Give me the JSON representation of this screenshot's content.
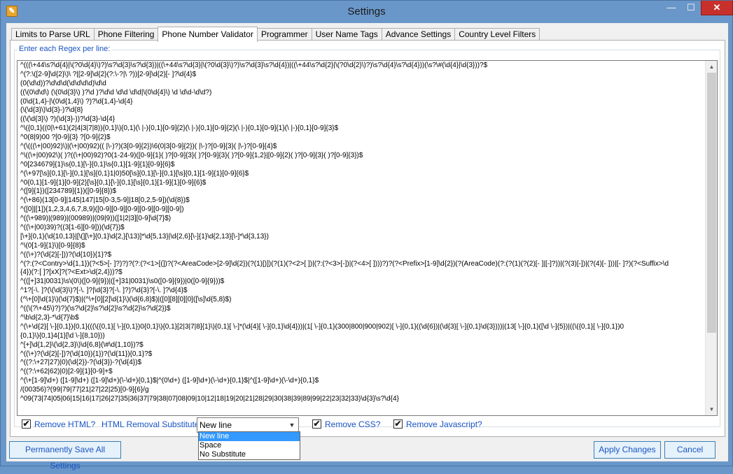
{
  "window": {
    "title": "Settings",
    "minimize_glyph": "—",
    "maximize_glyph": "☐",
    "close_glyph": "✕",
    "app_icon_glyph": "✎"
  },
  "tabs": [
    {
      "label": "Limits to Parse URL",
      "active": false
    },
    {
      "label": "Phone Filtering",
      "active": false
    },
    {
      "label": "Phone Number Validator",
      "active": true
    },
    {
      "label": "Programmer",
      "active": false
    },
    {
      "label": "User Name Tags",
      "active": false
    },
    {
      "label": "Advance Settings",
      "active": false
    },
    {
      "label": "Country Level Filters",
      "active": false
    }
  ],
  "regex_group": {
    "label": "Enter each Regex per line:",
    "lines": [
      "^(((\\+44\\s?\\d{4}|\\(?0\\d{4}\\)?)\\s?\\d{3}\\s?\\d{3})|((\\+44\\s?\\d{3}|\\(?0\\d{3}\\)?)\\s?\\d{3}\\s?\\d{4})|((\\+44\\s?\\d{2}|\\(?0\\d{2}\\)?)\\s?\\d{4}\\s?\\d{4}))(\\s?\\#(\\d{4}|\\d{3}))?$",
      "^(?:\\([2-9]\\d{2}\\)\\ ?|[2-9]\\d{2}(?:\\-?|\\ ?))[2-9]\\d{2}[- ]?\\d{4}$",
      "(0(\\d\\d))?\\d\\d\\d(\\d\\d\\d\\d)\\d\\d",
      "((\\(0\\d\\d\\) (\\(0\\d{3}\\) )?\\d )?\\d\\d \\d\\d \\d\\d|\\(0\\d{4}\\) \\d \\d\\d-\\d\\d?)",
      "(0\\d{1,4}-|\\(0\\d{1,4}\\) ?)?\\d{1,4}-\\d{4}",
      "(\\(\\d{3}\\)\\d{3}-)?\\d{8}",
      "((\\(\\d{3}\\) ?)(\\d{3}-))?\\d{3}-\\d{4}",
      "^\\({0,1}((0|\\+61)(2|4|3|7|8)){0,1}\\){0,1}(\\ |-){0,1}[0-9]{2}(\\ |-){0,1}[0-9]{2}(\\ |-){0,1}[0-9]{1}(\\ |-){0,1}[0-9]{3}$",
      "^0(8|9)00 ?[0-9]{3} ?[0-9]{2}$",
      "^(\\(((\\+|00)92)\\)|(\\+|00)92)(( |\\-)?)(3[0-9]{2})\\6(0|3[0-9]{2})( |\\-)?[0-9]{3}( |\\-)?[0-9]{4}$",
      "^\\((\\+|00)92\\)( )?((\\+|00)92)?0(1-24-9)([0-9]{1}( )?[0-9]{3}( )?[0-9]{3}( )?[0-9]{1,2}|[0-9]{2}( )?[0-9]{3}( )?[0-9]{3})$",
      "^0[234679]{1}\\s{0,1}[\\-]{0,1}\\s{0,1}[1-9]{1}[0-9]{6}$",
      "^(\\+97[\\s]{0,1}[\\-]{0,1}[\\s]{0,1}1|0)50[\\s]{0,1}[\\-]{0,1}[\\s]{0,1}[1-9]{1}[0-9]{6}$",
      "^0{0,1}[1-9]{1}[0-9]{2}[\\s]{0,1}[\\-]{0,1}[\\s]{0,1}[1-9]{1}[0-9]{6}$",
      "^([9]{1})([234789]{1})([0-9]{8})$",
      "^(\\+86)(13[0-9]|145|147|15[0-3,5-9]|18[0,2,5-9])(\\d{8})$",
      "^([0]|[1]){1,2,3,4,6,7,8,9}([0-9][0-9][0-9][0-9][0-9][0-9])",
      "^((\\+989)|(989)|(00989)|(09|9))([1|2|3][0-9]\\d{7}$)",
      "^((\\+|00)39)?((3[1-6][0-9]))(\\d{7})$",
      "[\\+]{0,1}(\\d{10,13}|[\\(][\\+]{0,1}\\d{2,}[\\13)]*\\d{5,13}|\\d{2,6}[\\-]{1}\\d{2,13}[\\-]*\\d{3,13})",
      "^\\(0[1-9]{1}\\)[0-9]{8}$",
      "^((\\+)?(\\d{2}[-]))?(\\d{10}){1}?$",
      "^(?:(?<Contry>\\d{1,1})(?<5>[- ]?)?)?(?:(?<1>[(])?(?<AreaCode>[2-9]\\d{2})(?(1)[)])(?(1)(?<2>[ ])|(?:(?<3>[-])|(?<4>[ ])))?)?(?<Prefix>[1-9]\\d{2})(?(AreaCode)(?:(?(1)(?(2)[- ]|[-]?))|(?(3)[-])|(?(4)[- ]))|[- ]?)(?<Suffix>\\d",
      "{4})(?:[ ]?[xX]?(?<Ext>\\d{2,4}))?$",
      "^(([+]31|0031)\\s\\(0\\)([0-9]{9})|([+]31|0031)\\s0([0-9]{9})|0([0-9]{9}))$",
      "^1?[-\\. ]?(\\(\\d{3}\\)?[-\\. ]?|\\d{3}?[-\\. ]?)?\\d{3}?[-\\. ]?\\d{4}$",
      "(^\\+[0]\\d{1}\\)(\\d{7}$)|(^\\+[0][2]\\d{1}\\)(\\d{6,8}$)|([0][8][0][0]([\\s]\\d{5,8}$)",
      "^((\\(?\\+45\\)?)?)(\\s?\\d{2}\\s?\\d{2}\\s?\\d{2}\\s?\\d{2})$",
      "^\\b\\d{2,3}-*\\d{7}\\b$",
      "^(\\+\\d{2}[ \\-]{0,1}){0,1}(((\\({0,1}[ \\-]{0,1})0{0,1}\\){0,1}[2|3|7|8]{1}\\){0,1}[ \\-]*(\\d{4}[ \\-]{0,1}\\d{4}))|(1[ \\-]{0,1}(300|800|900|902)[ \\-]{0,1}((\\d{6})|(\\d{3}[ \\-]{0,1}\\d{3})))|(13[ \\-]{0,1}([\\d \\-]{5})|((\\({0,1}[ \\-]{0,1})0",
      "{0,1}\\){0,1}4{1}[\\d \\-]{8,10}))",
      "^[+]\\d{1,2}\\(\\d{2,3}\\)\\d{6,8}(\\#\\d{1,10})?$",
      "^((\\+)?(\\d{2}[-])?(\\d{10}){1})?(\\d{11}){0,1}?$",
      "^((?:\\+27|27)|0)(\\d{2})-?(\\d{3})-?(\\d{4})$",
      "^((?:\\+62|62)|0)[2-9]{1}[0-9]+$",
      "^(\\+[1-9]\\d+) ([1-9]\\d+) ([1-9]\\d+)(\\-\\d+){0,1}$|^(0\\d+) ([1-9]\\d+)(\\-\\d+){0,1}$|^([1-9]\\d+)(\\-\\d+){0,1}$",
      "/(00356)?(99|79|77|21|27|22|25)[0-9]{6}/g",
      "^09(73|74|05|06|15|16|17|26|27|35|36|37|79|38|07|08|09|10|12|18|19|20|21|28|29|30|38|39|89|99|22|23|32|33)\\d{3}\\s?\\d{4}"
    ]
  },
  "options": {
    "remove_html": {
      "label": "Remove HTML?",
      "checked": true
    },
    "substitute": {
      "label": "HTML Removal Substitute:",
      "selected": "New line",
      "options": [
        "New line",
        "Space",
        "No Substitute"
      ]
    },
    "remove_css": {
      "label": "Remove CSS?",
      "checked": true
    },
    "remove_javascript": {
      "label": "Remove Javascript?",
      "checked": true
    }
  },
  "buttons": {
    "save_all": "Permanently Save All Settings",
    "apply": "Apply Changes",
    "cancel": "Cancel"
  },
  "scrollbar": {
    "up": "▲",
    "down": "▼"
  },
  "check_glyph": "✔",
  "dropdown_glyph": "▼"
}
